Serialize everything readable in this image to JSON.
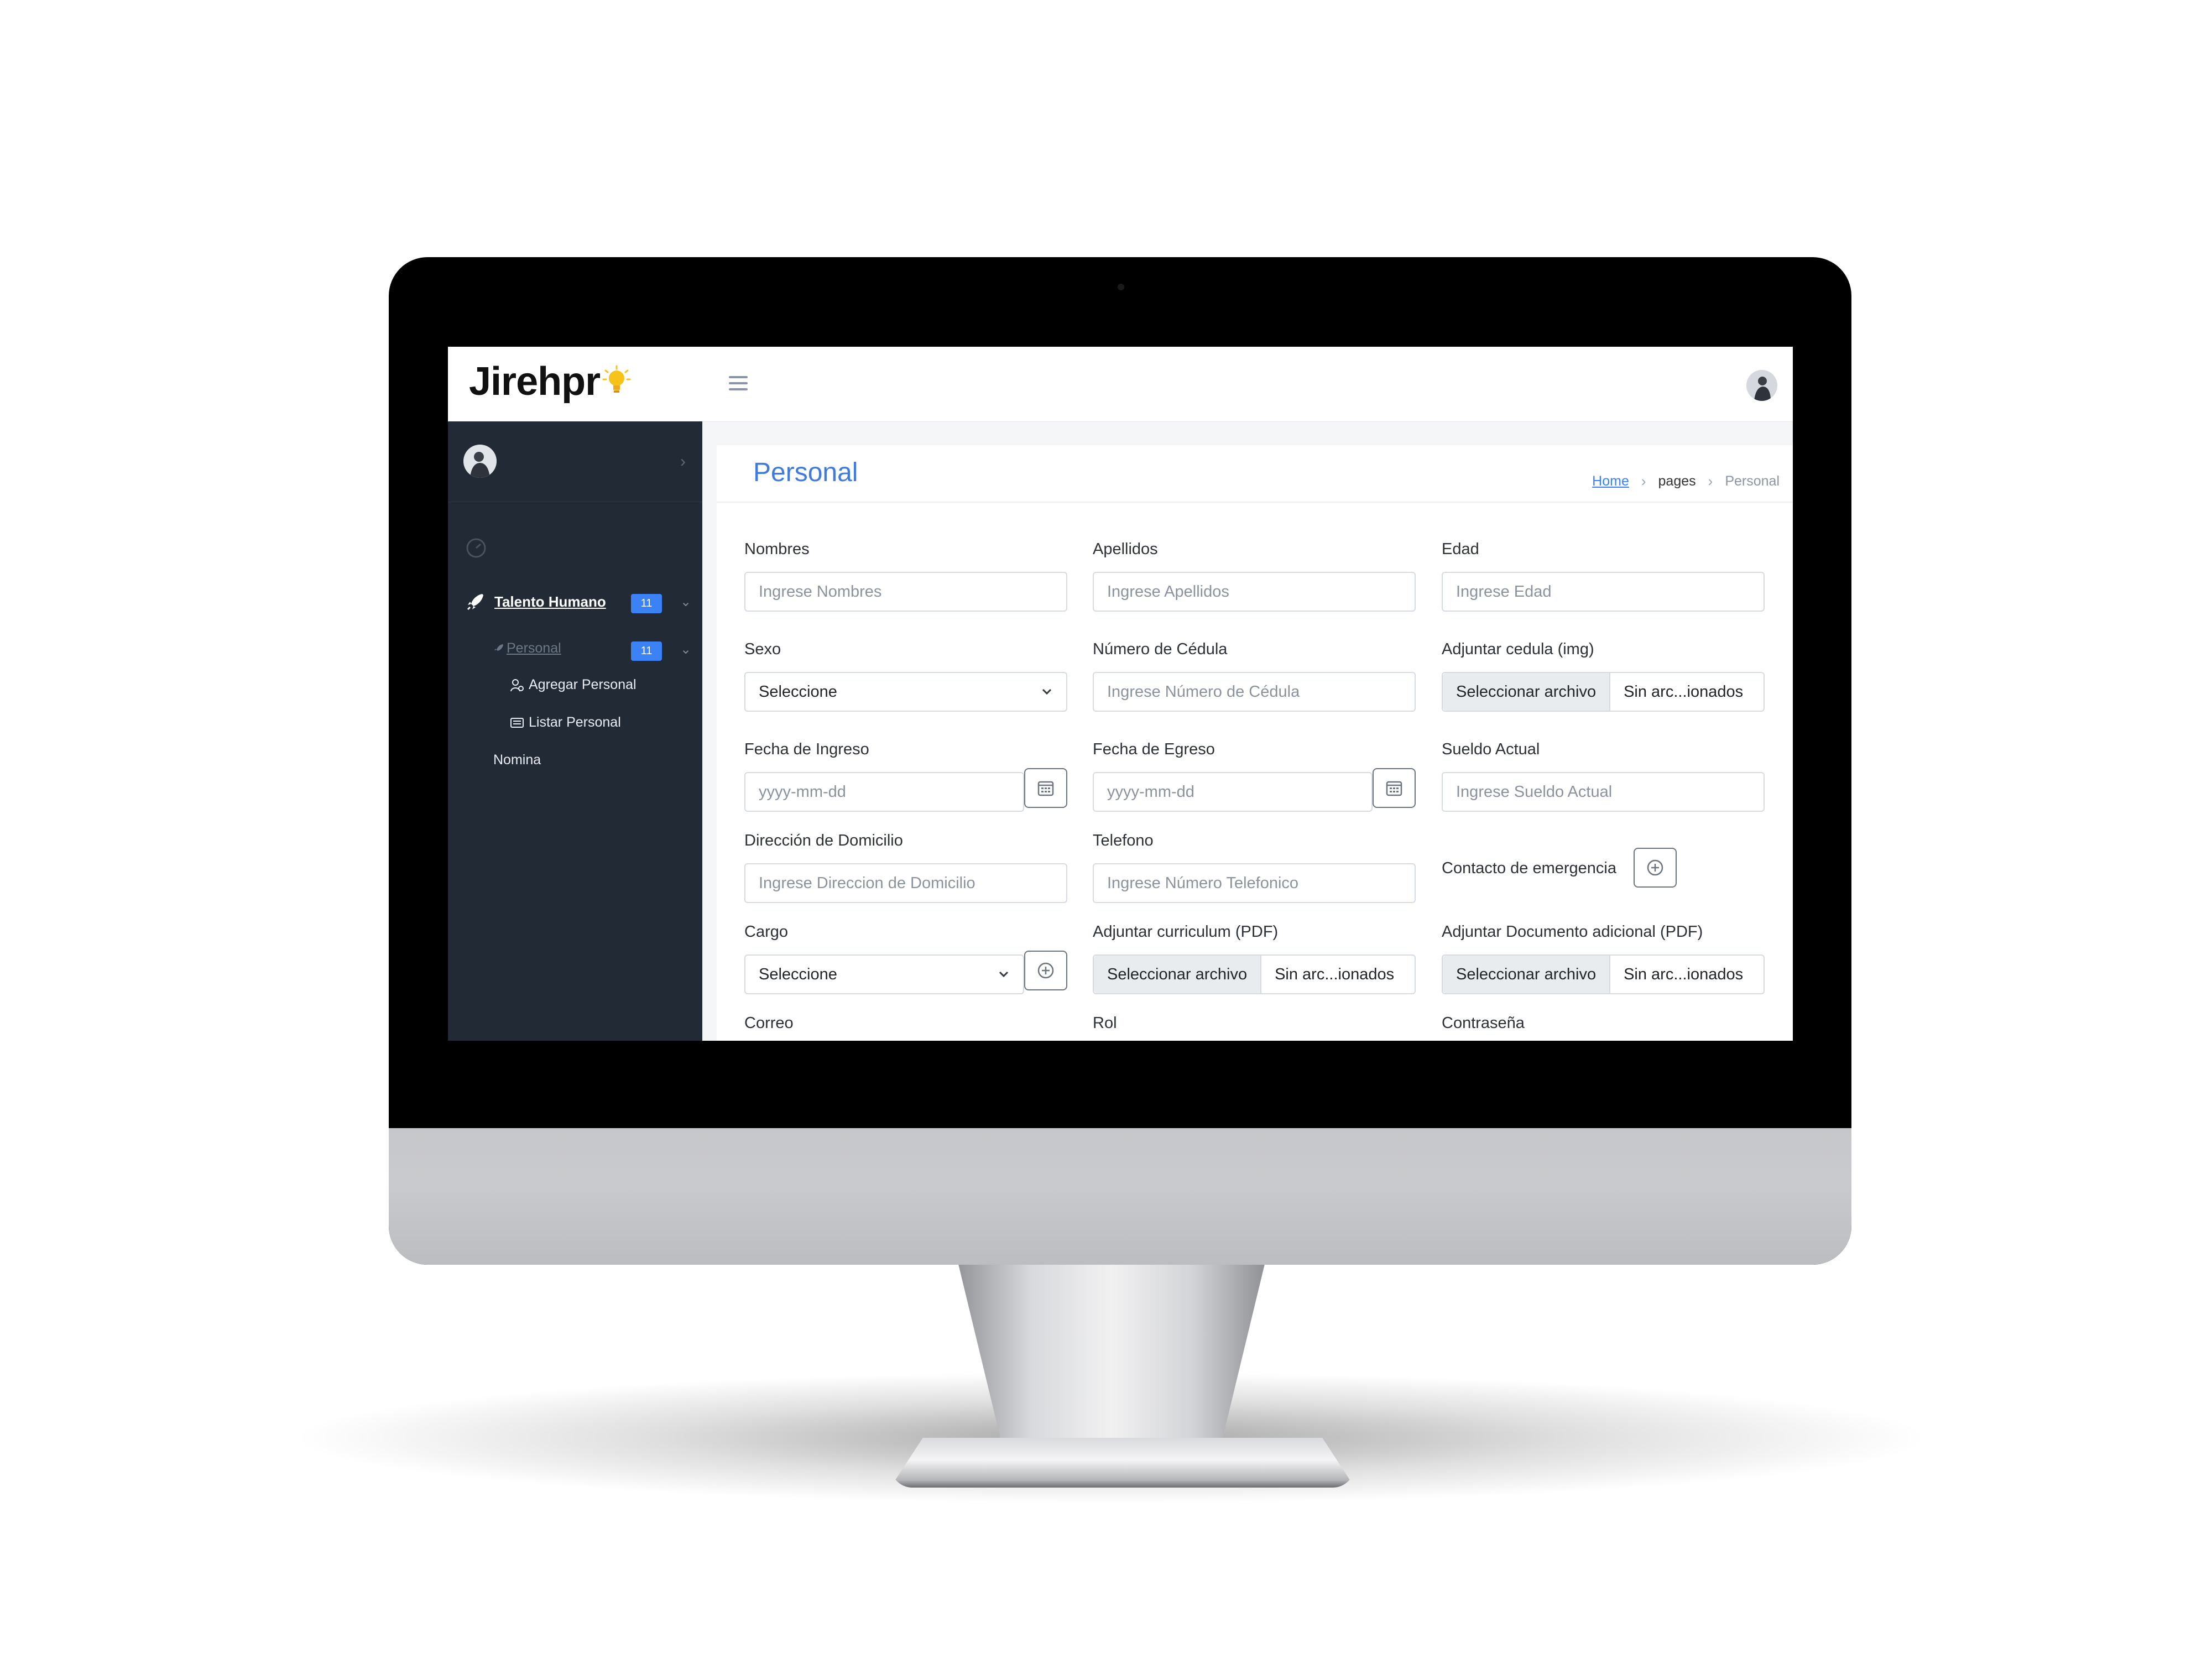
{
  "brand": {
    "logo_text": "Jirehpr"
  },
  "sidebar": {
    "talento_label": "Talento Humano",
    "talento_badge": "11",
    "personal_label": "Personal",
    "personal_badge": "11",
    "agregar_label": "Agregar Personal",
    "listar_label": "Listar Personal",
    "nomina_label": "Nomina"
  },
  "header": {
    "title": "Personal",
    "breadcrumb": {
      "home": "Home",
      "pages": "pages",
      "current": "Personal"
    }
  },
  "form": {
    "nombres": {
      "label": "Nombres",
      "placeholder": "Ingrese Nombres"
    },
    "apellidos": {
      "label": "Apellidos",
      "placeholder": "Ingrese Apellidos"
    },
    "edad": {
      "label": "Edad",
      "placeholder": "Ingrese Edad"
    },
    "sexo": {
      "label": "Sexo",
      "value": "Seleccione"
    },
    "cedula": {
      "label": "Número de Cédula",
      "placeholder": "Ingrese Número de Cédula"
    },
    "adjuntar_cedula": {
      "label": "Adjuntar cedula (img)",
      "button": "Seleccionar archivo",
      "status": "Sin arc...ionados"
    },
    "fecha_ingreso": {
      "label": "Fecha de Ingreso",
      "placeholder": "yyyy-mm-dd"
    },
    "fecha_egreso": {
      "label": "Fecha de Egreso",
      "placeholder": "yyyy-mm-dd"
    },
    "sueldo": {
      "label": "Sueldo Actual",
      "placeholder": "Ingrese Sueldo Actual"
    },
    "direccion": {
      "label": "Dirección de Domicilio",
      "placeholder": "Ingrese Direccion de Domicilio"
    },
    "telefono": {
      "label": "Telefono",
      "placeholder": "Ingrese Número Telefonico"
    },
    "contacto": {
      "label": "Contacto de emergencia"
    },
    "cargo": {
      "label": "Cargo",
      "value": "Seleccione"
    },
    "curriculum": {
      "label": "Adjuntar curriculum (PDF)",
      "button": "Seleccionar archivo",
      "status": "Sin arc...ionados"
    },
    "doc_adicional": {
      "label": "Adjuntar Documento adicional (PDF)",
      "button": "Seleccionar archivo",
      "status": "Sin arc...ionados"
    },
    "correo": {
      "label": "Correo"
    },
    "rol": {
      "label": "Rol"
    },
    "contrasena": {
      "label": "Contraseña"
    }
  },
  "colors": {
    "accent": "#3b82f6",
    "sidebar_bg": "#222a35",
    "title": "#3d7be0"
  }
}
